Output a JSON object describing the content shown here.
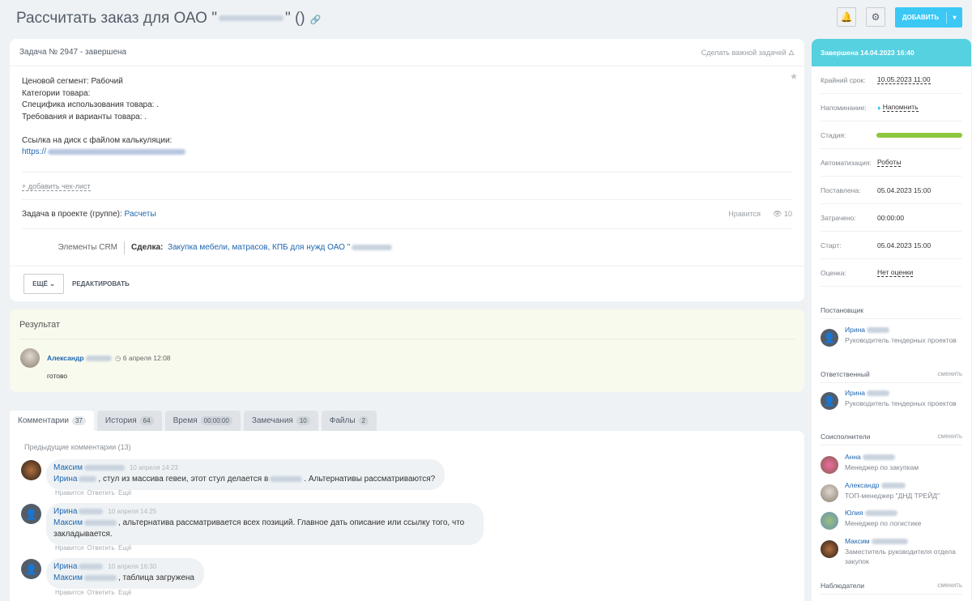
{
  "header": {
    "title": "Рассчитать заказ для ОАО \"",
    "title_suffix": "\" ()",
    "add_label": "ДОБАВИТЬ"
  },
  "task": {
    "heading": "Задача № 2947 - завершена",
    "make_important": "Сделать важной задачей",
    "description": [
      "Ценовой сегмент: Рабочий",
      "Категории товара:",
      "Специфика использования товара: .",
      "Требования и варианты товара: ."
    ],
    "link_label": "Ссылка на диск с файлом калькуляции:",
    "link_prefix": "https://",
    "add_checklist": "+ добавить чек-лист",
    "project_label": "Задача в проекте (группе):",
    "project": "Расчеты",
    "likes_label": "Нравится",
    "views": "10",
    "crm_label": "Элементы CRM",
    "deal_label": "Сделка:",
    "deal": "Закупка мебели, матрасов, КПБ для нужд ОАО \"",
    "more": "ЕЩЁ",
    "edit": "РЕДАКТИРОВАТЬ"
  },
  "result": {
    "title": "Результат",
    "author": "Александр",
    "time": "6 апреля 12:08",
    "text": "готово"
  },
  "tabs": [
    {
      "label": "Комментарии",
      "count": "37"
    },
    {
      "label": "История",
      "count": "64"
    },
    {
      "label": "Время",
      "count": "00:00:00"
    },
    {
      "label": "Замечания",
      "count": "10"
    },
    {
      "label": "Файлы",
      "count": "2"
    }
  ],
  "comments": {
    "previous": "Предыдущие комментарии (13)",
    "actions": [
      "Нравится",
      "Ответить",
      "Ещё"
    ],
    "items": [
      {
        "author": "Максим",
        "time": "10 апреля 14:23",
        "mention": "Ирина",
        "text1": ", стул из массива гевеи, этот стул делается в",
        "text2": ". Альтернативы рассматриваются?"
      },
      {
        "author": "Ирина",
        "time": "10 апреля 14:25",
        "mention": "Максим",
        "text1": ", альтернатива рассматривается всех позиций. Главное дать описание или ссылку того, что закладывается."
      },
      {
        "author": "Ирина",
        "time": "10 апреля 16:30",
        "mention": "Максим",
        "text1": ", таблица загружена"
      }
    ]
  },
  "sidebar": {
    "status": "Завершена 14.04.2023 16:40",
    "rows": [
      {
        "k": "Крайний срок:",
        "v": "10.05.2023 11:00"
      },
      {
        "k": "Напоминание:",
        "v": "Напомнить"
      },
      {
        "k": "Стадия:"
      },
      {
        "k": "Автоматизация:",
        "v": "Роботы"
      },
      {
        "k": "Поставлена:",
        "v": "05.04.2023 15:00"
      },
      {
        "k": "Затрачено:",
        "v": "00:00:00"
      },
      {
        "k": "Старт:",
        "v": "05.04.2023 15:00"
      },
      {
        "k": "Оценка:",
        "v": "Нет оценки"
      }
    ],
    "stage_progress": 1.0,
    "change": "сменить",
    "creator_label": "Постановщик",
    "creator": {
      "name": "Ирина",
      "pos": "Руководитель тендерных проектов"
    },
    "responsible_label": "Ответственный",
    "responsible": {
      "name": "Ирина",
      "pos": "Руководитель тендерных проектов"
    },
    "accomplices_label": "Соисполнители",
    "accomplices": [
      {
        "name": "Анна",
        "pos": "Менеджер по закупкам"
      },
      {
        "name": "Александр",
        "pos": "ТОП-менеджер \"ДНД ТРЕЙД\""
      },
      {
        "name": "Юлия",
        "pos": "Менеджер по логистике"
      },
      {
        "name": "Максим",
        "pos": "Заместитель руководителя отдела закупок"
      }
    ],
    "observers_label": "Наблюдатели"
  }
}
